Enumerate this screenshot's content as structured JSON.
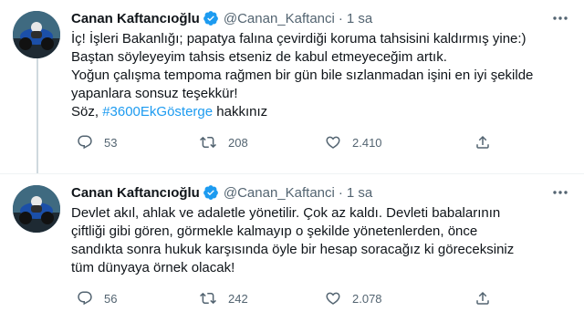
{
  "tweets": [
    {
      "name": "Canan Kaftancıoğlu",
      "handle": "@Canan_Kaftanci",
      "separator": "·",
      "time": "1 sa",
      "lines": [
        "İç! İşleri Bakanlığı; papatya falına çevirdiği koruma tahsisini  kaldırmış yine:)",
        "Baştan söyleyeyim tahsis etseniz de  kabul etmeyeceğim artık.",
        "Yoğun çalışma tempoma rağmen bir gün bile sızlanmadan işini en iyi şekilde",
        "yapanlara sonsuz teşekkür!"
      ],
      "last_line_prefix": "Söz, ",
      "hashtag": "#3600EkGösterge",
      "last_line_suffix": " hakkınız",
      "replies": "53",
      "retweets": "208",
      "likes": "2.410"
    },
    {
      "name": "Canan Kaftancıoğlu",
      "handle": "@Canan_Kaftanci",
      "separator": "·",
      "time": "1 sa",
      "lines": [
        "Devlet akıl, ahlak ve adaletle yönetilir. Çok az kaldı. Devleti babalarının",
        "çiftliği gibi gören, görmekle kalmayıp o şekilde yönetenlerden, önce",
        "sandıkta sonra hukuk karşısında öyle bir hesap soracağız ki göreceksiniz",
        "tüm dünyaya örnek olacak!"
      ],
      "replies": "56",
      "retweets": "242",
      "likes": "2.078"
    }
  ],
  "colors": {
    "text": "#0f1419",
    "secondary": "#536471",
    "link": "#1d9bf0",
    "verified": "#1d9bf0",
    "divider": "#eff3f4"
  },
  "icons": [
    "verified-badge-icon",
    "more-icon",
    "reply-icon",
    "retweet-icon",
    "like-icon",
    "share-icon"
  ]
}
